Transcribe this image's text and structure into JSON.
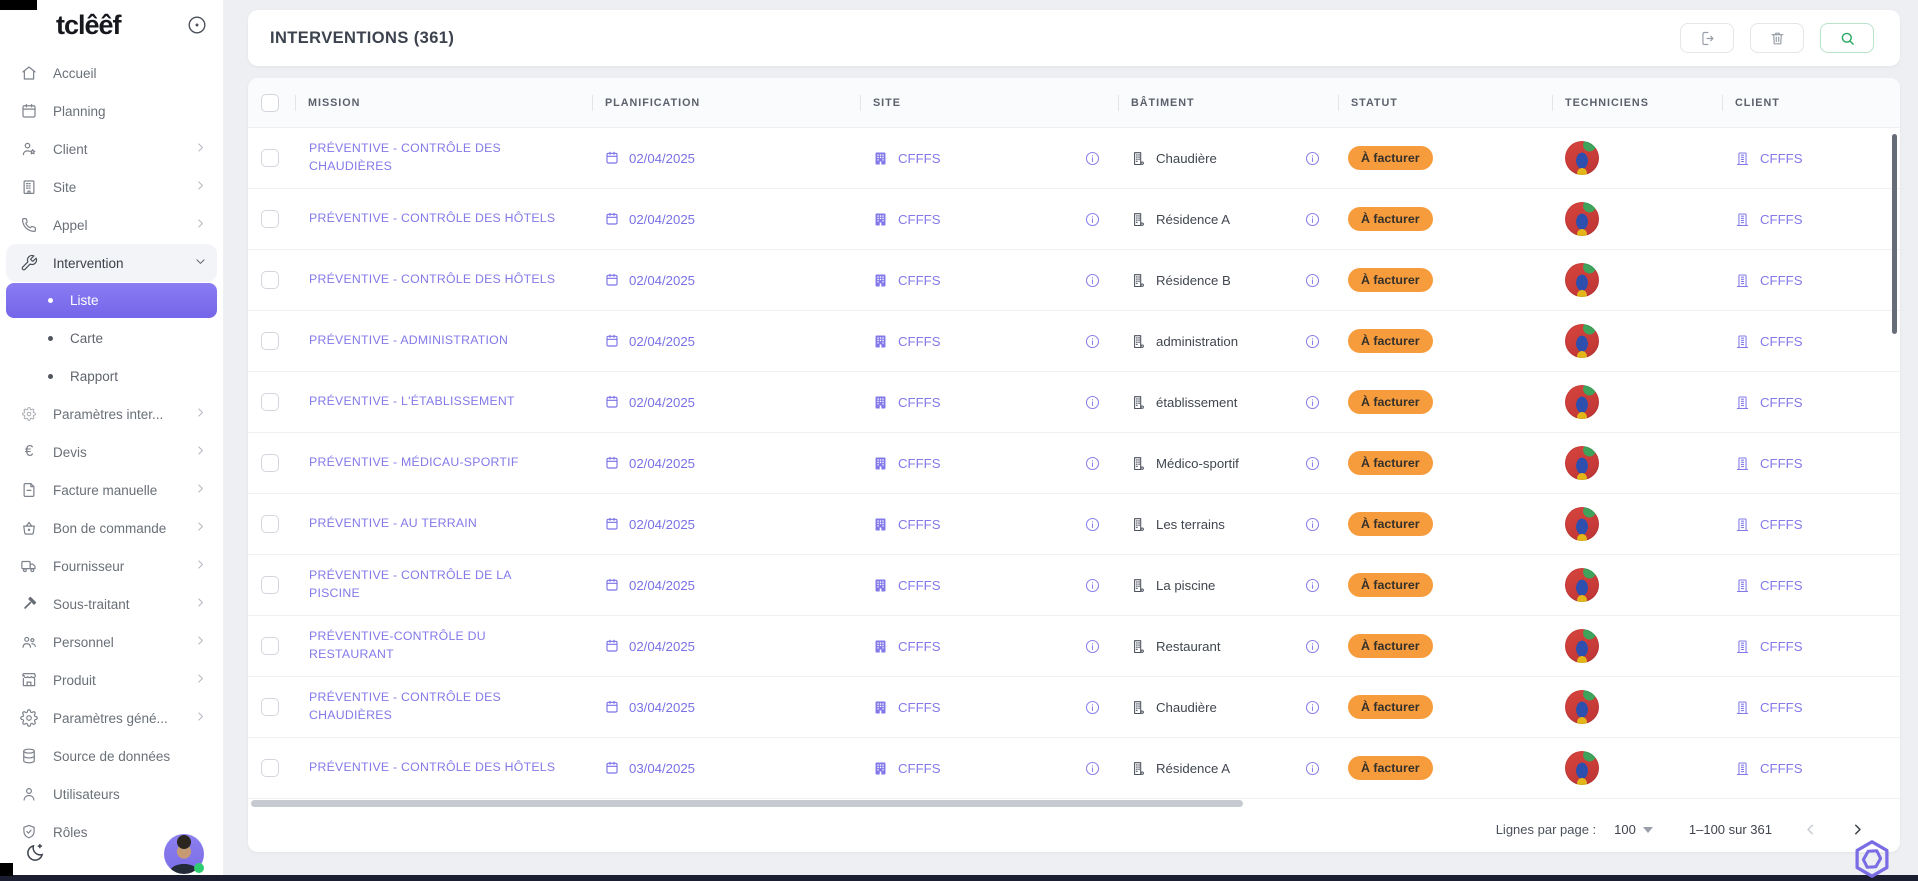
{
  "app": {
    "logo": "tclêêf"
  },
  "header": {
    "title": "INTERVENTIONS (361)"
  },
  "toolbar": {
    "buttons": [
      {
        "icon": "export"
      },
      {
        "icon": "trash"
      },
      {
        "icon": "search"
      }
    ]
  },
  "sidebar": {
    "items": [
      {
        "label": "Accueil",
        "icon": "home"
      },
      {
        "label": "Planning",
        "icon": "calendar"
      },
      {
        "label": "Client",
        "icon": "person-star",
        "expandable": true
      },
      {
        "label": "Site",
        "icon": "building",
        "expandable": true
      },
      {
        "label": "Appel",
        "icon": "phone",
        "expandable": true
      },
      {
        "label": "Intervention",
        "icon": "wrench",
        "expandable": true,
        "expanded": true,
        "children": [
          {
            "label": "Liste",
            "selected": true
          },
          {
            "label": "Carte"
          },
          {
            "label": "Rapport"
          }
        ]
      },
      {
        "label": "Paramètres inter...",
        "icon": "gear-small",
        "expandable": true
      },
      {
        "label": "Devis",
        "icon": "euro",
        "expandable": true
      },
      {
        "label": "Facture manuelle",
        "icon": "invoice",
        "expandable": true
      },
      {
        "label": "Bon de commande",
        "icon": "basket",
        "expandable": true
      },
      {
        "label": "Fournisseur",
        "icon": "truck",
        "expandable": true
      },
      {
        "label": "Sous-traitant",
        "icon": "hammer",
        "expandable": true
      },
      {
        "label": "Personnel",
        "icon": "people",
        "expandable": true
      },
      {
        "label": "Produit",
        "icon": "store",
        "expandable": true
      },
      {
        "label": "Paramètres géné...",
        "icon": "gear",
        "expandable": true
      },
      {
        "label": "Source de données",
        "icon": "database"
      },
      {
        "label": "Utilisateurs",
        "icon": "user"
      },
      {
        "label": "Rôles",
        "icon": "shield"
      }
    ]
  },
  "table": {
    "columns": [
      "MISSION",
      "PLANIFICATION",
      "SITE",
      "BÂTIMENT",
      "STATUT",
      "TECHNICIENS",
      "CLIENT"
    ],
    "rows": [
      {
        "mission": "PRÉVENTIVE - CONTRÔLE DES CHAUDIÈRES",
        "date": "02/04/2025",
        "site": "CFFFS",
        "batiment": "Chaudière",
        "statut": "À facturer",
        "client": "CFFFS"
      },
      {
        "mission": "PRÉVENTIVE - CONTRÔLE DES HÔTELS",
        "date": "02/04/2025",
        "site": "CFFFS",
        "batiment": "Résidence A",
        "statut": "À facturer",
        "client": "CFFFS"
      },
      {
        "mission": "PRÉVENTIVE - CONTRÔLE DES HÔTELS",
        "date": "02/04/2025",
        "site": "CFFFS",
        "batiment": "Résidence B",
        "statut": "À facturer",
        "client": "CFFFS"
      },
      {
        "mission": "PRÉVENTIVE - ADMINISTRATION",
        "date": "02/04/2025",
        "site": "CFFFS",
        "batiment": "administration",
        "statut": "À facturer",
        "client": "CFFFS"
      },
      {
        "mission": "PRÉVENTIVE - L'ÉTABLISSEMENT",
        "date": "02/04/2025",
        "site": "CFFFS",
        "batiment": "établissement",
        "statut": "À facturer",
        "client": "CFFFS"
      },
      {
        "mission": "PRÉVENTIVE - MÉDICAU-SPORTIF",
        "date": "02/04/2025",
        "site": "CFFFS",
        "batiment": "Médico-sportif",
        "statut": "À facturer",
        "client": "CFFFS"
      },
      {
        "mission": "PRÉVENTIVE - AU TERRAIN",
        "date": "02/04/2025",
        "site": "CFFFS",
        "batiment": "Les terrains",
        "statut": "À facturer",
        "client": "CFFFS"
      },
      {
        "mission": "PRÉVENTIVE - CONTRÔLE DE LA PISCINE",
        "date": "02/04/2025",
        "site": "CFFFS",
        "batiment": "La piscine",
        "statut": "À facturer",
        "client": "CFFFS"
      },
      {
        "mission": "PRÉVENTIVE-CONTRÔLE DU RESTAURANT",
        "date": "02/04/2025",
        "site": "CFFFS",
        "batiment": "Restaurant",
        "statut": "À facturer",
        "client": "CFFFS"
      },
      {
        "mission": "PRÉVENTIVE - CONTRÔLE DES CHAUDIÈRES",
        "date": "03/04/2025",
        "site": "CFFFS",
        "batiment": "Chaudière",
        "statut": "À facturer",
        "client": "CFFFS"
      },
      {
        "mission": "PRÉVENTIVE - CONTRÔLE DES HÔTELS",
        "date": "03/04/2025",
        "site": "CFFFS",
        "batiment": "Résidence A",
        "statut": "À facturer",
        "client": "CFFFS"
      }
    ]
  },
  "pagination": {
    "per_page_label": "Lignes par page :",
    "per_page_value": "100",
    "range": "1–100 sur 361"
  },
  "colors": {
    "accent_purple": "#7F72E8",
    "nav_selected": "#8071EE",
    "badge_orange": "#F79C3D",
    "search_green": "#27A661"
  }
}
